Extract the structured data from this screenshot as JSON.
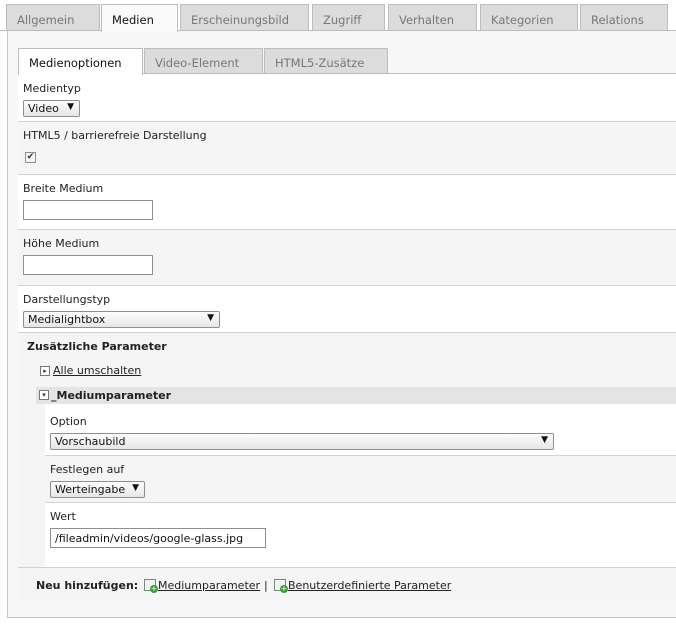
{
  "top_tabs": [
    {
      "label": "Allgemein"
    },
    {
      "label": "Medien"
    },
    {
      "label": "Erscheinungsbild"
    },
    {
      "label": "Zugriff"
    },
    {
      "label": "Verhalten"
    },
    {
      "label": "Kategorien"
    },
    {
      "label": "Relations"
    }
  ],
  "inner_tabs": [
    {
      "label": "Medienoptionen"
    },
    {
      "label": "Video-Element"
    },
    {
      "label": "HTML5-Zusätze"
    }
  ],
  "form": {
    "medientyp_label": "Medientyp",
    "medientyp_value": "Video",
    "html5_label": "HTML5 / barrierefreie Darstellung",
    "html5_checked": "✔",
    "breite_label": "Breite Medium",
    "breite_value": "",
    "hoehe_label": "Höhe Medium",
    "hoehe_value": "",
    "darstellung_label": "Darstellungstyp",
    "darstellung_value": "Medialightbox"
  },
  "params": {
    "title": "Zusätzliche Parameter",
    "toggle_all": "Alle umschalten",
    "section_title": "_Mediumparameter",
    "option_label": "Option",
    "option_value": "Vorschaubild",
    "festlegen_label": "Festlegen auf",
    "festlegen_value": "Werteingabe",
    "wert_label": "Wert",
    "wert_value": "/fileadmin/videos/google-glass.jpg"
  },
  "footer": {
    "new_label": "Neu hinzufügen:",
    "link1": "Mediumparameter",
    "separator": "|",
    "link2": "Benutzerdefinierte Parameter"
  }
}
